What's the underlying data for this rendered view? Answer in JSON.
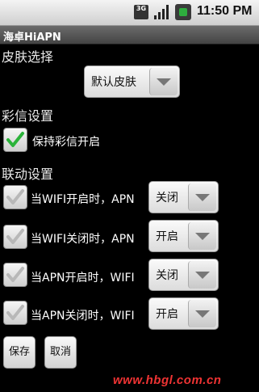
{
  "status_bar": {
    "network": "3G",
    "time": "11:50 PM"
  },
  "app": {
    "title": "海卓HiAPN"
  },
  "skin": {
    "section_label": "皮肤选择",
    "selected": "默认皮肤"
  },
  "mms": {
    "section_label": "彩信设置",
    "keep_on_label": "保持彩信开启",
    "keep_on_checked": true
  },
  "linkage": {
    "section_label": "联动设置",
    "rules": [
      {
        "label": "当WIFI开启时，APN",
        "value": "关闭",
        "checked": false
      },
      {
        "label": "当WIFI关闭时，APN",
        "value": "开启",
        "checked": false
      },
      {
        "label": "当APN开启时，WIFI",
        "value": "关闭",
        "checked": false
      },
      {
        "label": "当APN关闭时，WIFI",
        "value": "开启",
        "checked": false
      }
    ]
  },
  "actions": {
    "save_label": "保存",
    "cancel_label": "取消"
  },
  "watermark": "www.hbgl.com.cn"
}
